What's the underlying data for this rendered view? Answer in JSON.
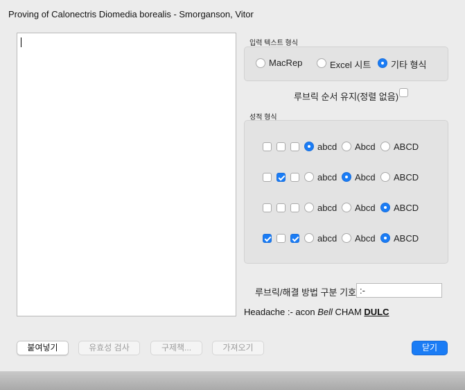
{
  "window": {
    "title": "Proving of Calonectris Diomedia borealis - Smorganson, Vitor"
  },
  "input_format": {
    "label": "입력 텍스트 형식",
    "options": [
      {
        "label": "MacRep",
        "selected": false
      },
      {
        "label": "Excel 시트",
        "selected": false
      },
      {
        "label": "기타 형식",
        "selected": true
      }
    ]
  },
  "keep_order": {
    "label": "루브릭 순서 유지(정렬 없음)",
    "checked": false
  },
  "grade_format": {
    "label": "성적 형식",
    "rows": [
      {
        "checks": [
          false,
          false,
          false
        ],
        "options": [
          "abcd",
          "Abcd",
          "ABCD"
        ],
        "selected": 0
      },
      {
        "checks": [
          false,
          true,
          false
        ],
        "options": [
          "abcd",
          "Abcd",
          "ABCD"
        ],
        "selected": 1
      },
      {
        "checks": [
          false,
          false,
          false
        ],
        "options": [
          "abcd",
          "Abcd",
          "ABCD"
        ],
        "selected": 2
      },
      {
        "checks": [
          true,
          false,
          true
        ],
        "options": [
          "abcd",
          "Abcd",
          "ABCD"
        ],
        "selected": 2
      }
    ]
  },
  "separator": {
    "label": "루브릭/해결 방법 구분 기호",
    "value": ":-"
  },
  "example": {
    "prefix": "Headache :- acon ",
    "italic": "Bell",
    "middle": " CHAM ",
    "underlined": "DULC"
  },
  "buttons": {
    "paste": "붙여넣기",
    "validate": "유효성 검사",
    "structure": "구제책...",
    "import": "가져오기",
    "close": "닫기"
  }
}
